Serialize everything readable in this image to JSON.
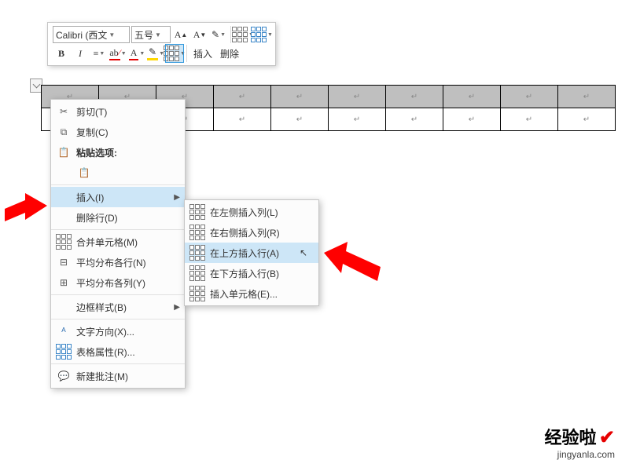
{
  "toolbar": {
    "font_name": "Calibri (西文",
    "font_size": "五号",
    "insert_label": "插入",
    "delete_label": "删除"
  },
  "context_menu": {
    "cut": "剪切(T)",
    "copy": "复制(C)",
    "paste_options": "粘贴选项:",
    "insert": "插入(I)",
    "delete_rows": "删除行(D)",
    "merge_cells": "合并单元格(M)",
    "distribute_rows": "平均分布各行(N)",
    "distribute_cols": "平均分布各列(Y)",
    "border_style": "边框样式(B)",
    "text_direction": "文字方向(X)...",
    "table_properties": "表格属性(R)...",
    "new_comment": "新建批注(M)"
  },
  "insert_submenu": {
    "cols_left": "在左侧插入列(L)",
    "cols_right": "在右侧插入列(R)",
    "rows_above": "在上方插入行(A)",
    "rows_below": "在下方插入行(B)",
    "cells": "插入单元格(E)..."
  },
  "watermark": {
    "title": "经验啦",
    "site": "jingyanla.com"
  }
}
